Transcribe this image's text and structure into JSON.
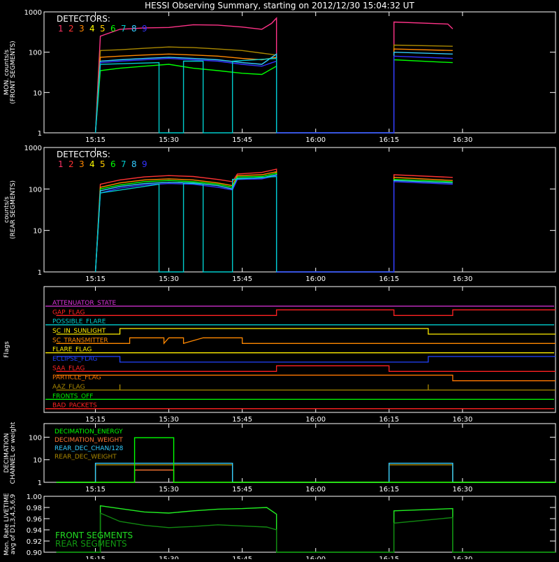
{
  "title": "HESSI Observing Summary, starting on 2012/12/30 15:04:32 UT",
  "time_ticks": [
    "15:15",
    "15:30",
    "15:45",
    "16:00",
    "16:15",
    "16:30"
  ],
  "detector_colors": [
    "#ff3333",
    "#ff3333",
    "#ff8800",
    "#ffff00",
    "#ff8800",
    "#00ff00",
    "#00cccc",
    "#33ddff",
    "#0000ff"
  ],
  "chart_data": [
    {
      "type": "line",
      "ylabel": "MON. counts/s (FRONT SEGMENTS)",
      "ylabel_lines": [
        "MON. counts/s",
        "(FRONT SEGMENTS)"
      ],
      "yscale": "log",
      "ylim": [
        1,
        1000
      ],
      "yticks": [
        "1",
        "10",
        "100",
        "1000"
      ],
      "xlim_minutes": [
        15.07,
        16.82
      ],
      "legend_title": "DETECTORS:",
      "legend_entries": [
        "1",
        "2",
        "3",
        "4",
        "5",
        "6",
        "7",
        "8",
        "9"
      ],
      "legend_colors": [
        "#ff3366",
        "#ff3333",
        "#ff8800",
        "#ffff00",
        "#ffcc00",
        "#00ff00",
        "#00cccc",
        "#33ccff",
        "#3333ff"
      ],
      "series": [
        {
          "name": "1",
          "color": "#ff3388",
          "x": [
            "15:15",
            "15:16",
            "15:20",
            "15:25",
            "15:30",
            "15:35",
            "15:40",
            "15:45",
            "15:49",
            "15:51",
            "15:52",
            "15:52",
            "16:16",
            "16:16",
            "16:27",
            "16:28"
          ],
          "y": [
            1,
            250,
            370,
            400,
            410,
            480,
            470,
            420,
            370,
            520,
            700,
            1,
            1,
            560,
            500,
            380
          ]
        },
        {
          "name": "2",
          "color": "#aa8800",
          "x": [
            "15:15",
            "15:16",
            "15:20",
            "15:25",
            "15:30",
            "15:35",
            "15:40",
            "15:45",
            "15:49",
            "15:52",
            "15:52",
            "16:16",
            "16:16",
            "16:28"
          ],
          "y": [
            1,
            110,
            115,
            125,
            135,
            130,
            120,
            110,
            95,
            85,
            1,
            1,
            150,
            140
          ]
        },
        {
          "name": "3",
          "color": "#ff8800",
          "x": [
            "15:15",
            "15:16",
            "15:20",
            "15:25",
            "15:30",
            "15:35",
            "15:40",
            "15:45",
            "15:49",
            "15:52",
            "15:52",
            "16:16",
            "16:16",
            "16:28"
          ],
          "y": [
            1,
            75,
            80,
            85,
            90,
            85,
            80,
            70,
            65,
            75,
            1,
            1,
            120,
            110
          ]
        },
        {
          "name": "6",
          "color": "#00ff00",
          "x": [
            "15:15",
            "15:16",
            "15:20",
            "15:25",
            "15:30",
            "15:35",
            "15:40",
            "15:45",
            "15:49",
            "15:52",
            "15:52",
            "16:16",
            "16:16",
            "16:28"
          ],
          "y": [
            1,
            35,
            40,
            45,
            50,
            40,
            35,
            30,
            28,
            45,
            1,
            1,
            65,
            55
          ]
        },
        {
          "name": "8",
          "color": "#33ccff",
          "x": [
            "15:15",
            "15:16",
            "15:20",
            "15:25",
            "15:30",
            "15:35",
            "15:40",
            "15:45",
            "15:49",
            "15:52",
            "15:52",
            "16:16",
            "16:16",
            "16:28"
          ],
          "y": [
            1,
            60,
            65,
            70,
            75,
            70,
            65,
            55,
            50,
            90,
            1,
            1,
            100,
            90
          ]
        },
        {
          "name": "9",
          "color": "#3333ff",
          "x": [
            "15:15",
            "15:16",
            "15:20",
            "15:25",
            "15:30",
            "15:35",
            "15:40",
            "15:45",
            "15:49",
            "15:52",
            "15:52",
            "16:16",
            "16:16",
            "16:28"
          ],
          "y": [
            1,
            55,
            60,
            65,
            70,
            65,
            60,
            50,
            45,
            60,
            1,
            1,
            80,
            70
          ]
        },
        {
          "name": "7",
          "color": "#00cccc",
          "x": [
            "15:15",
            "15:16",
            "15:28",
            "15:28",
            "15:33",
            "15:33",
            "15:37",
            "15:37",
            "15:43",
            "15:43",
            "15:52",
            "15:52"
          ],
          "y": [
            1,
            50,
            55,
            1,
            1,
            60,
            60,
            1,
            1,
            60,
            70,
            1
          ]
        }
      ]
    },
    {
      "type": "line",
      "ylabel": "counts/s (REAR SEGMENTS)",
      "ylabel_lines": [
        "counts/s",
        "(REAR SEGMENTS)"
      ],
      "yscale": "log",
      "ylim": [
        1,
        1000
      ],
      "yticks": [
        "1",
        "10",
        "100",
        "1000"
      ],
      "xlim_minutes": [
        15.07,
        16.82
      ],
      "legend_title": "DETECTORS:",
      "legend_entries": [
        "1",
        "2",
        "3",
        "4",
        "5",
        "6",
        "7",
        "8",
        "9"
      ],
      "legend_colors": [
        "#ff3366",
        "#ff3333",
        "#ff8800",
        "#ffff00",
        "#ffcc00",
        "#00ff00",
        "#00cccc",
        "#33ccff",
        "#3333ff"
      ],
      "series": [
        {
          "name": "2",
          "color": "#ff3333",
          "x": [
            "15:15",
            "15:16",
            "15:20",
            "15:25",
            "15:30",
            "15:35",
            "15:40",
            "15:43",
            "15:44",
            "15:49",
            "15:52",
            "15:52",
            "16:16",
            "16:16",
            "16:28"
          ],
          "y": [
            1,
            130,
            165,
            195,
            210,
            200,
            170,
            150,
            230,
            250,
            300,
            1,
            1,
            220,
            190
          ]
        },
        {
          "name": "3",
          "color": "#ff8800",
          "x": [
            "15:15",
            "15:16",
            "15:20",
            "15:25",
            "15:30",
            "15:35",
            "15:40",
            "15:43",
            "15:44",
            "15:49",
            "15:52",
            "15:52",
            "16:16",
            "16:16",
            "16:28"
          ],
          "y": [
            1,
            110,
            140,
            165,
            175,
            165,
            140,
            120,
            210,
            220,
            260,
            1,
            1,
            190,
            160
          ]
        },
        {
          "name": "6",
          "color": "#00ff00",
          "x": [
            "15:15",
            "15:16",
            "15:20",
            "15:25",
            "15:30",
            "15:35",
            "15:40",
            "15:43",
            "15:44",
            "15:49",
            "15:52",
            "15:52",
            "16:16",
            "16:16",
            "16:28"
          ],
          "y": [
            1,
            100,
            125,
            150,
            160,
            150,
            130,
            110,
            195,
            200,
            240,
            1,
            1,
            170,
            150
          ]
        },
        {
          "name": "8",
          "color": "#33ccff",
          "x": [
            "15:15",
            "15:16",
            "15:20",
            "15:25",
            "15:30",
            "15:35",
            "15:40",
            "15:43",
            "15:44",
            "15:49",
            "15:52",
            "15:52",
            "16:16",
            "16:16",
            "16:28"
          ],
          "y": [
            1,
            90,
            115,
            135,
            145,
            140,
            120,
            100,
            180,
            185,
            220,
            1,
            1,
            160,
            140
          ]
        },
        {
          "name": "9",
          "color": "#3333ff",
          "x": [
            "15:15",
            "15:16",
            "15:20",
            "15:25",
            "15:30",
            "15:35",
            "15:40",
            "15:43",
            "15:44",
            "15:49",
            "15:52",
            "15:52",
            "16:16",
            "16:16",
            "16:28"
          ],
          "y": [
            1,
            80,
            105,
            125,
            135,
            130,
            110,
            95,
            170,
            175,
            210,
            1,
            1,
            150,
            130
          ]
        },
        {
          "name": "7",
          "color": "#00cccc",
          "x": [
            "15:15",
            "15:16",
            "15:28",
            "15:28",
            "15:33",
            "15:33",
            "15:37",
            "15:37",
            "15:43",
            "15:43",
            "15:52",
            "15:52"
          ],
          "y": [
            1,
            80,
            130,
            1,
            1,
            140,
            130,
            1,
            1,
            170,
            200,
            1
          ]
        }
      ]
    },
    {
      "type": "line",
      "ylabel": "Flags",
      "xlim_minutes": [
        15.07,
        16.82
      ],
      "flags": [
        {
          "label": "ATTENUATOR_STATE",
          "color": "#dd33dd",
          "x": [],
          "high": []
        },
        {
          "label": "GAP_FLAG",
          "color": "#ff2222",
          "x": [
            "15:07",
            "15:52",
            "15:52",
            "16:16",
            "16:16",
            "16:28",
            "16:28",
            "16:49"
          ],
          "high": [
            0,
            0,
            1,
            1,
            0,
            0,
            1,
            1
          ]
        },
        {
          "label": "POSSIBLE_FLARE",
          "color": "#00cccc",
          "x": [],
          "high": []
        },
        {
          "label": "SC_IN_SUNLIGHT",
          "color": "#ffee00",
          "x": [
            "15:07",
            "15:20",
            "15:20",
            "16:23",
            "16:23",
            "16:49"
          ],
          "high": [
            0,
            0,
            1,
            1,
            0,
            0
          ]
        },
        {
          "label": "SC_TRANSMITTER",
          "color": "#ff8800",
          "x": [
            "15:07",
            "15:22",
            "15:22",
            "15:29",
            "15:29",
            "15:30",
            "15:30",
            "15:33",
            "15:33",
            "15:37",
            "15:37",
            "15:45",
            "15:45",
            "16:49"
          ],
          "high": [
            0,
            0,
            1,
            1,
            0,
            1,
            1,
            1,
            0,
            1,
            1,
            1,
            0,
            0
          ]
        },
        {
          "label": "FLARE_FLAG",
          "color": "#ffee00",
          "x": [],
          "high": []
        },
        {
          "label": "ECLIPSE_FLAG",
          "color": "#2244ff",
          "x": [
            "15:07",
            "15:20",
            "15:20",
            "16:23",
            "16:23",
            "16:49"
          ],
          "high": [
            1,
            1,
            0,
            0,
            1,
            1
          ]
        },
        {
          "label": "SAA_FLAG",
          "color": "#ff2222",
          "x": [
            "15:07",
            "15:52",
            "15:52",
            "16:15",
            "16:15",
            "16:49"
          ],
          "high": [
            0,
            0,
            1,
            1,
            0,
            0
          ]
        },
        {
          "label": "PARTICLE_FLAG",
          "color": "#ff7700",
          "x": [
            "15:07",
            "16:28",
            "16:28",
            "16:49"
          ],
          "high": [
            1,
            1,
            0,
            0
          ]
        },
        {
          "label": "AAZ_FLAG",
          "color": "#aa8800",
          "x": [
            "15:07",
            "15:20",
            "15:20",
            "15:20",
            "15:20",
            "16:23",
            "16:23",
            "16:23",
            "16:23",
            "16:49"
          ],
          "high": [
            0,
            0,
            1,
            1,
            0,
            0,
            1,
            1,
            0,
            0
          ]
        },
        {
          "label": "FRONTS_OFF",
          "color": "#00ee00",
          "x": [],
          "high": []
        },
        {
          "label": "BAD_PACKETS",
          "color": "#ff2222",
          "x": [],
          "high": []
        }
      ]
    },
    {
      "type": "line",
      "ylabel": "DECIMATION CHANNEL or weight",
      "ylabel_lines": [
        "DECIMATION",
        "CHANNEL or weight"
      ],
      "yscale": "log",
      "ylim": [
        1,
        400
      ],
      "yticks": [
        "1",
        "10",
        "100"
      ],
      "xlim_minutes": [
        15.07,
        16.82
      ],
      "legend_entries": [
        "DECIMATION_ENERGY",
        "DECIMATION_WEIGHT",
        "REAR_DEC_CHAN/128",
        "REAR_DEC_WEIGHT"
      ],
      "legend_colors": [
        "#00ff00",
        "#ff7733",
        "#33ccff",
        "#aa8800"
      ],
      "series": [
        {
          "name": "REAR_DEC_WEIGHT",
          "color": "#aa8800",
          "x": [
            "15:07",
            "15:15",
            "15:15",
            "15:43",
            "15:43",
            "16:15",
            "16:15",
            "16:28",
            "16:28",
            "16:49"
          ],
          "y": [
            1,
            1,
            6,
            6,
            1,
            1,
            6,
            6,
            1,
            1
          ]
        },
        {
          "name": "REAR_DEC_CHAN/128",
          "color": "#33ccff",
          "x": [
            "15:07",
            "15:15",
            "15:15",
            "15:43",
            "15:43",
            "16:15",
            "16:15",
            "16:28",
            "16:28",
            "16:49"
          ],
          "y": [
            1,
            1,
            7,
            7,
            1,
            1,
            7,
            7,
            1,
            1
          ]
        },
        {
          "name": "DECIMATION_WEIGHT",
          "color": "#ff7733",
          "x": [
            "15:07",
            "15:23",
            "15:23",
            "15:31",
            "15:31",
            "16:49"
          ],
          "y": [
            1,
            1,
            3.5,
            3.5,
            1,
            1
          ]
        },
        {
          "name": "DECIMATION_ENERGY",
          "color": "#00ff00",
          "x": [
            "15:07",
            "15:23",
            "15:23",
            "15:31",
            "15:31",
            "16:49"
          ],
          "y": [
            1,
            1,
            95,
            95,
            1,
            1
          ]
        }
      ]
    },
    {
      "type": "line",
      "ylabel": "Mon. Rate LIVETIME avg of D1,3,4,5,6,9",
      "ylabel_lines": [
        "Mon. Rate LIVETIME",
        "avg of D1,3,4,5,6,9"
      ],
      "yscale": "linear",
      "ylim": [
        0.9,
        1.0
      ],
      "yticks": [
        "0.90",
        "0.92",
        "0.94",
        "0.96",
        "0.98",
        "1.00"
      ],
      "xlim_minutes": [
        15.07,
        16.82
      ],
      "legend_entries": [
        "FRONT SEGMENTS",
        "REAR SEGMENTS"
      ],
      "legend_colors": [
        "#22dd22",
        "#119911"
      ],
      "series": [
        {
          "name": "FRONT SEGMENTS",
          "color": "#22ee22",
          "x": [
            "15:07",
            "15:16",
            "15:16",
            "15:20",
            "15:25",
            "15:30",
            "15:35",
            "15:40",
            "15:45",
            "15:50",
            "15:52",
            "15:52",
            "16:16",
            "16:16",
            "16:28",
            "16:28",
            "16:49"
          ],
          "y": [
            0.9,
            0.9,
            0.983,
            0.978,
            0.972,
            0.97,
            0.974,
            0.977,
            0.978,
            0.98,
            0.968,
            0.9,
            0.9,
            0.974,
            0.978,
            0.9,
            0.9
          ]
        },
        {
          "name": "REAR SEGMENTS",
          "color": "#118811",
          "x": [
            "15:07",
            "15:16",
            "15:16",
            "15:20",
            "15:25",
            "15:30",
            "15:35",
            "15:40",
            "15:45",
            "15:50",
            "15:52",
            "15:52",
            "16:16",
            "16:16",
            "16:28",
            "16:28",
            "16:49"
          ],
          "y": [
            0.9,
            0.9,
            0.97,
            0.955,
            0.948,
            0.944,
            0.946,
            0.949,
            0.947,
            0.945,
            0.94,
            0.9,
            0.9,
            0.952,
            0.962,
            0.9,
            0.9
          ]
        }
      ]
    }
  ]
}
